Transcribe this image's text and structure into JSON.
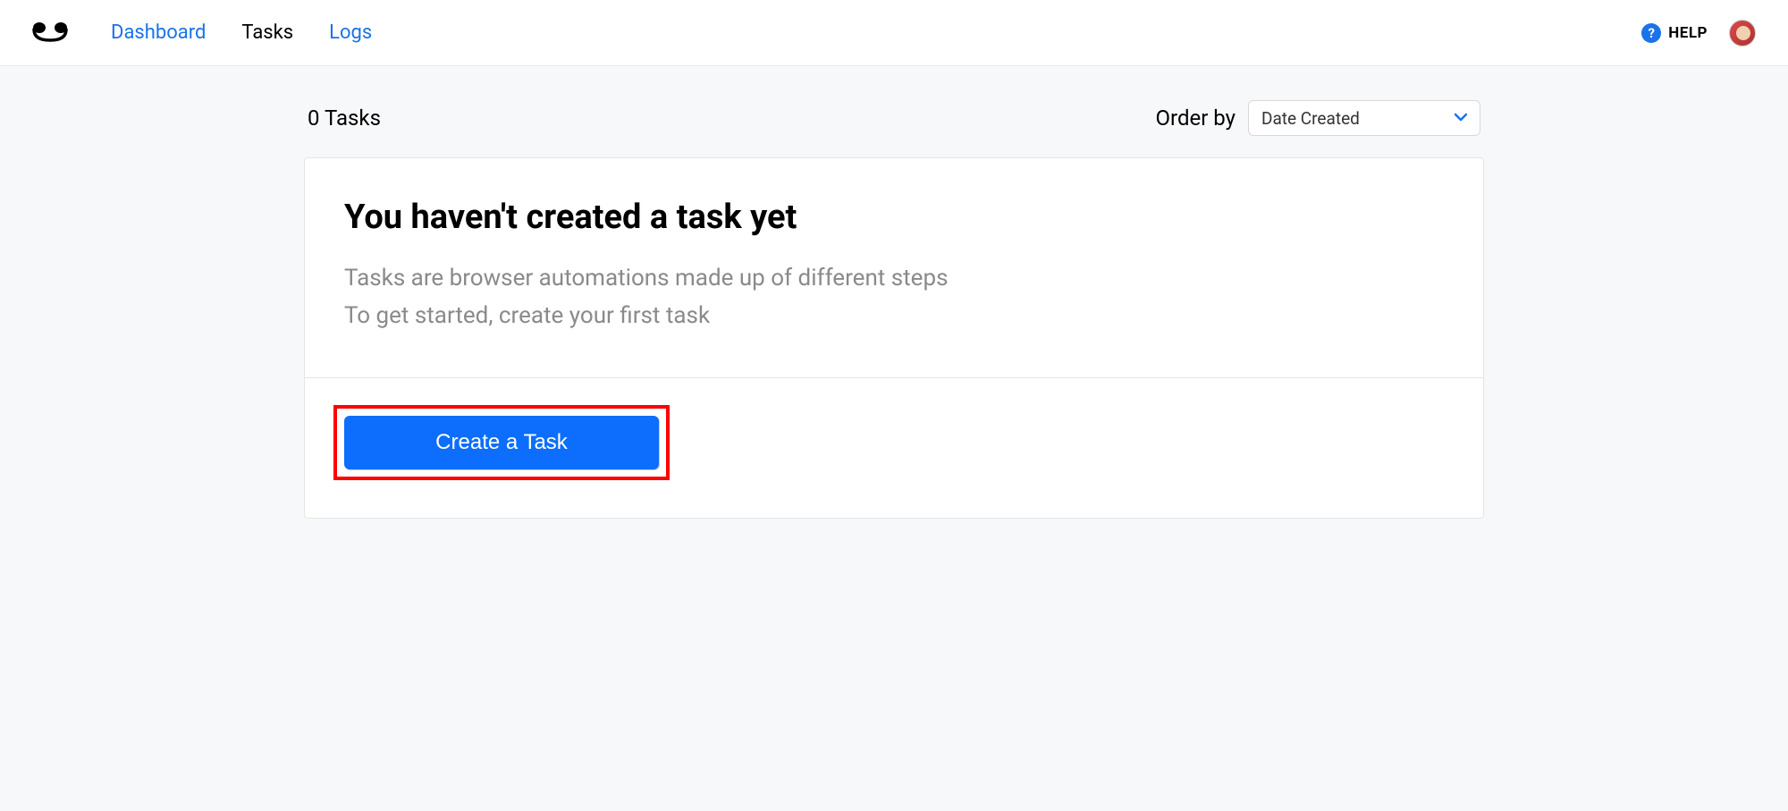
{
  "nav": {
    "dashboard": "Dashboard",
    "tasks": "Tasks",
    "logs": "Logs"
  },
  "header": {
    "help": "HELP"
  },
  "toolbar": {
    "task_count": "0 Tasks",
    "order_by_label": "Order by",
    "order_by_value": "Date Created"
  },
  "empty_state": {
    "title": "You haven't created a task yet",
    "line1": "Tasks are browser automations made up of different steps",
    "line2": "To get started, create your first task",
    "button": "Create a Task"
  }
}
